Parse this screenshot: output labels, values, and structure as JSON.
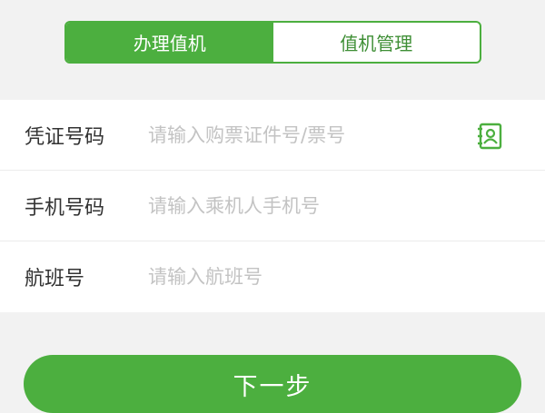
{
  "tabs": [
    {
      "label": "办理值机",
      "active": true
    },
    {
      "label": "值机管理",
      "active": false
    }
  ],
  "form": {
    "rows": [
      {
        "label": "凭证号码",
        "placeholder": "请输入购票证件号/票号",
        "value": "",
        "icon": "contact-book-icon"
      },
      {
        "label": "手机号码",
        "placeholder": "请输入乘机人手机号",
        "value": ""
      },
      {
        "label": "航班号",
        "placeholder": "请输入航班号",
        "value": ""
      }
    ]
  },
  "next_button": {
    "label": "下一步"
  },
  "colors": {
    "accent": "#4caf3f",
    "background": "#f2f2f2",
    "placeholder": "#c3c3c3"
  }
}
